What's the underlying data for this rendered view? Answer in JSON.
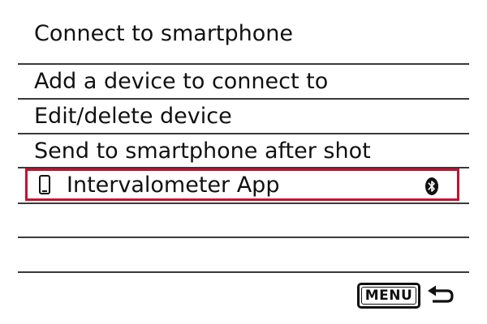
{
  "screen": {
    "title": "Connect to smartphone",
    "items": [
      {
        "label": "Add a device to connect to"
      },
      {
        "label": "Edit/delete device"
      },
      {
        "label": "Send to smartphone after shot"
      }
    ],
    "selected_device": {
      "label": "Intervalometer App",
      "device_icon": "smartphone-icon",
      "status_icon": "bluetooth-icon"
    },
    "footer": {
      "menu_label": "MENU",
      "return_icon": "return-arrow-icon"
    }
  },
  "colors": {
    "selection_border": "#c8102e",
    "text": "#111111",
    "background": "#ffffff"
  }
}
